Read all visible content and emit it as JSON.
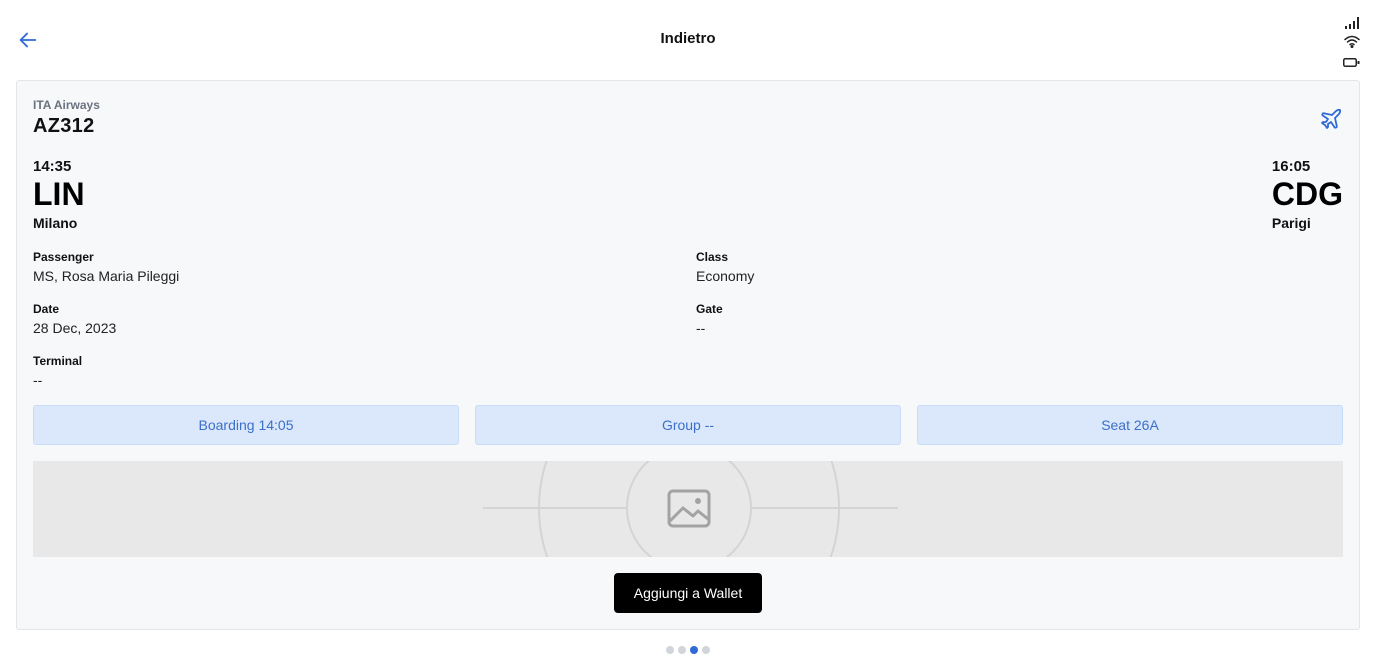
{
  "header": {
    "title": "Indietro",
    "back_icon": "arrow-left-icon",
    "status_icons": [
      "cellular-signal-icon",
      "wifi-icon",
      "battery-icon"
    ]
  },
  "ticket": {
    "airline": "ITA Airways",
    "flight_number": "AZ312",
    "plane_icon": "airplane-icon",
    "departure": {
      "time": "14:35",
      "code": "LIN",
      "city": "Milano"
    },
    "arrival": {
      "time": "16:05",
      "code": "CDG",
      "city": "Parigi"
    },
    "fields": {
      "passenger": {
        "label": "Passenger",
        "value": "MS, Rosa Maria Pileggi"
      },
      "class": {
        "label": "Class",
        "value": "Economy"
      },
      "date": {
        "label": "Date",
        "value": "28 Dec, 2023"
      },
      "gate": {
        "label": "Gate",
        "value": "--"
      },
      "terminal": {
        "label": "Terminal",
        "value": "--"
      }
    },
    "pills": {
      "boarding": "Boarding 14:05",
      "group": "Group --",
      "seat": "Seat 26A"
    },
    "barcode_icon": "image-placeholder-icon",
    "wallet_button": "Aggiungi a Wallet"
  },
  "pagination": {
    "total": 4,
    "active": 3
  },
  "colors": {
    "accent": "#2f6ad6",
    "pill_bg": "#dbe8fc",
    "pill_text": "#3b6fc9",
    "card_bg": "#f7f8fa",
    "button_bg": "#000000"
  }
}
